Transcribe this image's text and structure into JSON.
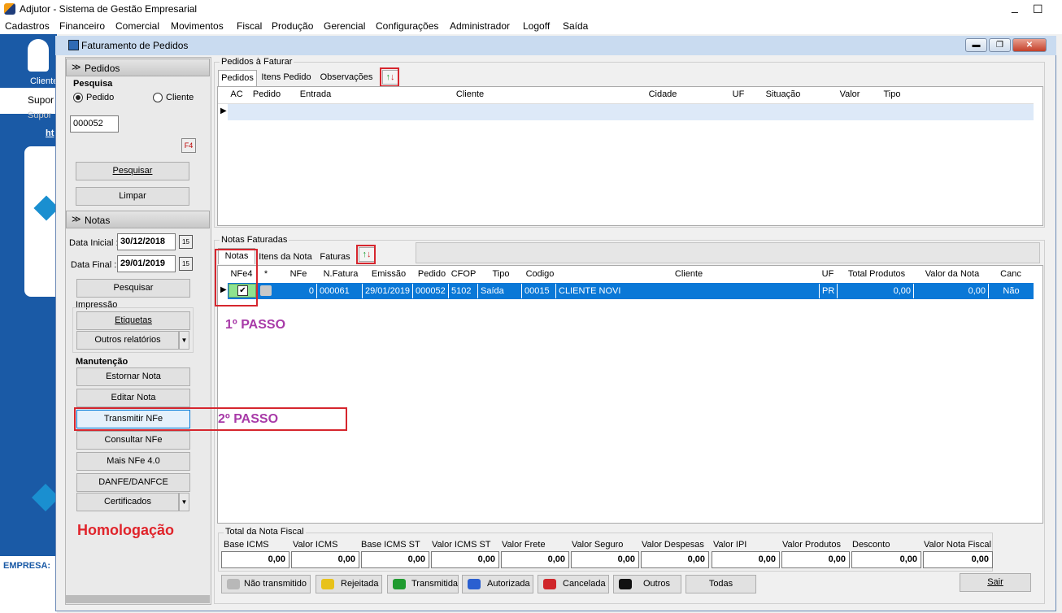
{
  "app": {
    "title": "Adjutor - Sistema de Gestão Empresarial"
  },
  "menu": [
    "Cadastros",
    "Financeiro",
    "Comercial",
    "Movimentos",
    "Fiscal",
    "Produção",
    "Gerencial",
    "Configurações",
    "Administrador",
    "Logoff",
    "Saída"
  ],
  "background": {
    "client_label": "Cliente",
    "suporte": "Supor",
    "suporte2": "Supor",
    "link": "ht",
    "empresa": "EMPRESA:"
  },
  "window": {
    "title": "Faturamento de Pedidos"
  },
  "left": {
    "pedidos_header": "Pedidos",
    "pesquisa_label": "Pesquisa",
    "radio_pedido": "Pedido",
    "radio_cliente": "Cliente",
    "pedido_value": "000052",
    "f4_label": "F4",
    "pesquisar": "Pesquisar",
    "limpar": "Limpar",
    "notas_header": "Notas",
    "data_inicial_label": "Data Inicial :",
    "data_inicial": "30/12/2018",
    "data_final_label": "Data Final :",
    "data_final": "29/01/2019",
    "cal_icon": "15",
    "pesquisar2": "Pesquisar",
    "impressao": "Impressão",
    "etiquetas": "Etiquetas",
    "outros": "Outros relatórios",
    "manutencao": "Manutenção",
    "estornar": "Estornar Nota",
    "editar": "Editar Nota",
    "transmitir": "Transmitir NFe",
    "consultar": "Consultar NFe",
    "mais": "Mais NFe 4.0",
    "danfe": "DANFE/DANFCE",
    "certificados": "Certificados",
    "homolog": "Homologação"
  },
  "pedidos_faturar": {
    "title": "Pedidos à Faturar",
    "tabs": [
      "Pedidos",
      "Itens Pedido",
      "Observações"
    ],
    "columns": [
      "AC",
      "Pedido",
      "Entrada",
      "Cliente",
      "Cidade",
      "UF",
      "Situação",
      "Valor",
      "Tipo"
    ]
  },
  "notas_faturadas": {
    "title": "Notas Faturadas",
    "tabs": [
      "Notas",
      "Itens da Nota",
      "Faturas"
    ],
    "columns": [
      "NFe4",
      "*",
      "NFe",
      "N.Fatura",
      "Emissão",
      "Pedido",
      "CFOP",
      "Tipo",
      "Codigo",
      "Cliente",
      "UF",
      "Total Produtos",
      "Valor da Nota",
      "Canc"
    ],
    "row": {
      "nfe4_checked": true,
      "nfe": "0",
      "fatura": "000061",
      "emissao": "29/01/2019",
      "pedido": "000052",
      "cfop": "5102",
      "tipo": "Saída",
      "codigo": "00015",
      "cliente": "CLIENTE NOVI",
      "uf": "PR",
      "total": "0,00",
      "valor": "0,00",
      "canc": "Não"
    }
  },
  "annotations": {
    "passo1": "1º PASSO",
    "passo2": "2º PASSO"
  },
  "totais": {
    "title": "Total da Nota Fiscal",
    "labels": [
      "Base ICMS",
      "Valor ICMS",
      "Base ICMS ST",
      "Valor ICMS ST",
      "Valor Frete",
      "Valor Seguro",
      "Valor Despesas",
      "Valor IPI",
      "Valor Produtos",
      "Desconto",
      "Valor Nota Fiscal"
    ],
    "values": [
      "0,00",
      "0,00",
      "0,00",
      "0,00",
      "0,00",
      "0,00",
      "0,00",
      "0,00",
      "0,00",
      "0,00",
      "0,00"
    ]
  },
  "legend": [
    {
      "label": "Não transmitido",
      "color": "#b8b8b8"
    },
    {
      "label": "Rejeitada",
      "color": "#e8c21a"
    },
    {
      "label": "Transmitida",
      "color": "#1f9b2f"
    },
    {
      "label": "Autorizada",
      "color": "#2a5fd0"
    },
    {
      "label": "Cancelada",
      "color": "#d0262a"
    },
    {
      "label": "Outros",
      "color": "#111111"
    }
  ],
  "todas": "Todas",
  "sair": "Sair",
  "colors": {
    "selection": "#0a78d7",
    "nfe_green": "#8fe38f",
    "annotation_purple": "#a83aa8",
    "annotation_red": "#d6262e"
  }
}
